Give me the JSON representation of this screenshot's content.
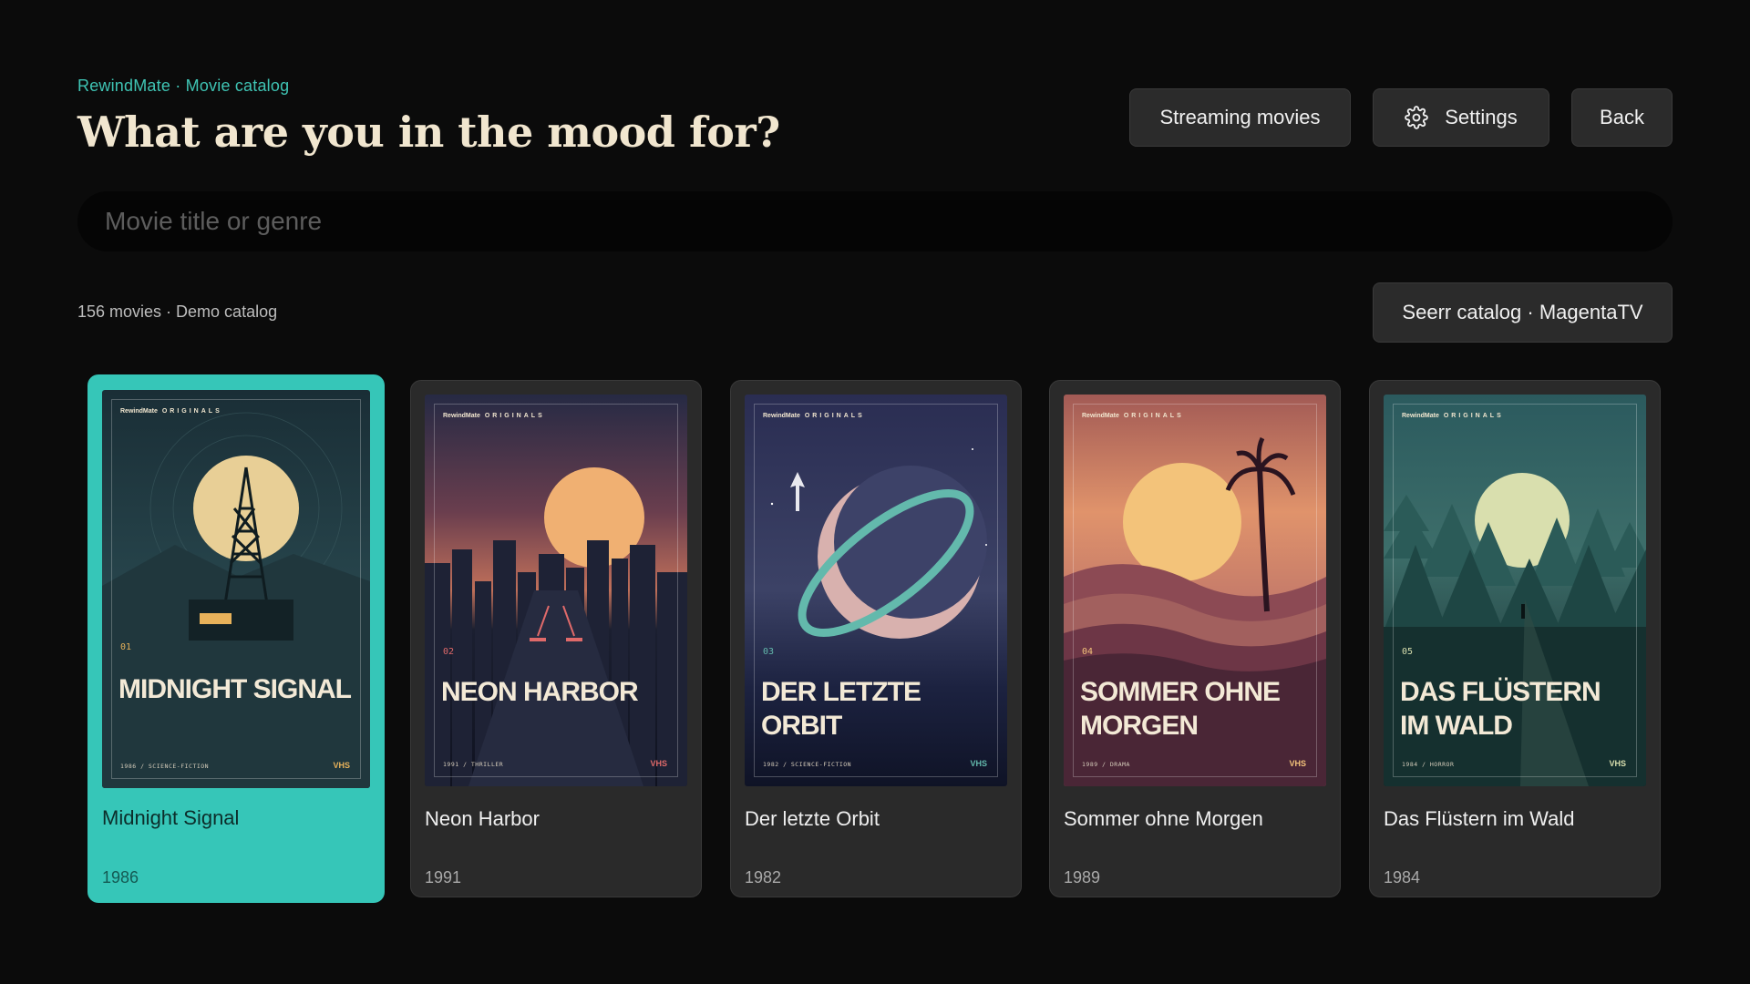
{
  "header": {
    "eyebrow": "RewindMate · Movie catalog",
    "title": "What are you in the mood for?",
    "buttons": {
      "streaming": "Streaming movies",
      "settings": "Settings",
      "back": "Back"
    }
  },
  "search": {
    "placeholder": "Movie title or genre",
    "value": ""
  },
  "catalog": {
    "count": "156 movies · Demo catalog",
    "source_button": "Seerr catalog · MagentaTV"
  },
  "colors": {
    "accent": "#36c6b8",
    "title": "#f1e6cf",
    "background": "#0b0b0b",
    "card": "#2a2a2a"
  },
  "poster_brand": {
    "name": "RewindMate",
    "line": "ORIGINALS",
    "format": "VHS"
  },
  "movies": [
    {
      "num": "01",
      "poster_title": "MIDNIGHT SIGNAL",
      "title": "Midnight Signal",
      "year": "1986",
      "meta": "1986   /   SCIENCE-FICTION",
      "selected": true
    },
    {
      "num": "02",
      "poster_title": "NEON HARBOR",
      "title": "Neon Harbor",
      "year": "1991",
      "meta": "1991   /   THRILLER",
      "selected": false
    },
    {
      "num": "03",
      "poster_title": "DER LETZTE ORBIT",
      "title": "Der letzte Orbit",
      "year": "1982",
      "meta": "1982   /   SCIENCE-FICTION",
      "selected": false
    },
    {
      "num": "04",
      "poster_title": "SOMMER OHNE MORGEN",
      "title": "Sommer ohne Morgen",
      "year": "1989",
      "meta": "1989   /   DRAMA",
      "selected": false
    },
    {
      "num": "05",
      "poster_title": "DAS FLÜSTERN IM WALD",
      "title": "Das Flüstern im Wald",
      "year": "1984",
      "meta": "1984   /   HORROR",
      "selected": false
    }
  ]
}
